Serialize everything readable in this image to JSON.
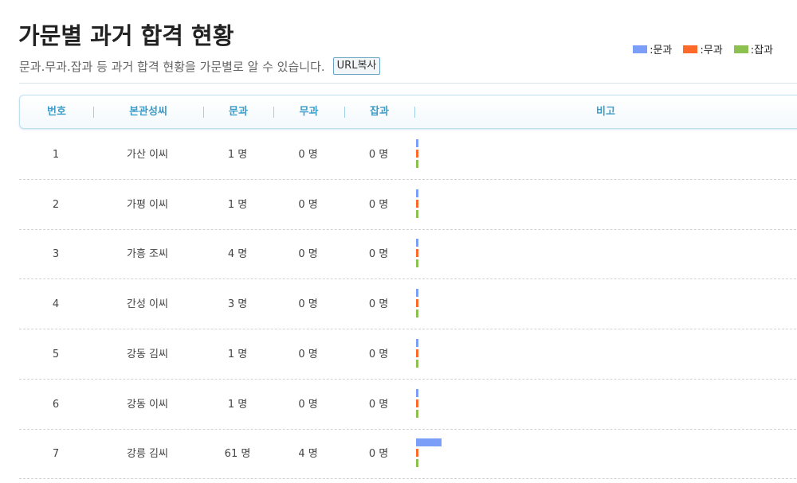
{
  "header": {
    "title": "가문별 과거 합격 현황",
    "description": "문과.무과.잡과 등 과거 합격 현황을 가문별로 알 수 있습니다.",
    "url_button_label": "URL복사"
  },
  "legend": [
    {
      "label": ":문과",
      "color": "#7b9ef9"
    },
    {
      "label": ":무과",
      "color": "#ff6a2b"
    },
    {
      "label": ":잡과",
      "color": "#8cc152"
    }
  ],
  "table": {
    "columns": [
      "번호",
      "본관성씨",
      "문과",
      "무과",
      "잡과",
      "비고"
    ],
    "rows": [
      {
        "no": "1",
        "clan": "가산 이씨",
        "mungwa": "1 명",
        "mugwa": "0 명",
        "japgwa": "0 명",
        "counts": [
          1,
          0,
          0
        ]
      },
      {
        "no": "2",
        "clan": "가평 이씨",
        "mungwa": "1 명",
        "mugwa": "0 명",
        "japgwa": "0 명",
        "counts": [
          1,
          0,
          0
        ]
      },
      {
        "no": "3",
        "clan": "가흥 조씨",
        "mungwa": "4 명",
        "mugwa": "0 명",
        "japgwa": "0 명",
        "counts": [
          4,
          0,
          0
        ]
      },
      {
        "no": "4",
        "clan": "간성 이씨",
        "mungwa": "3 명",
        "mugwa": "0 명",
        "japgwa": "0 명",
        "counts": [
          3,
          0,
          0
        ]
      },
      {
        "no": "5",
        "clan": "강동 김씨",
        "mungwa": "1 명",
        "mugwa": "0 명",
        "japgwa": "0 명",
        "counts": [
          1,
          0,
          0
        ]
      },
      {
        "no": "6",
        "clan": "강동 이씨",
        "mungwa": "1 명",
        "mugwa": "0 명",
        "japgwa": "0 명",
        "counts": [
          1,
          0,
          0
        ]
      },
      {
        "no": "7",
        "clan": "강릉 김씨",
        "mungwa": "61 명",
        "mugwa": "4 명",
        "japgwa": "0 명",
        "counts": [
          61,
          4,
          0
        ]
      }
    ]
  }
}
